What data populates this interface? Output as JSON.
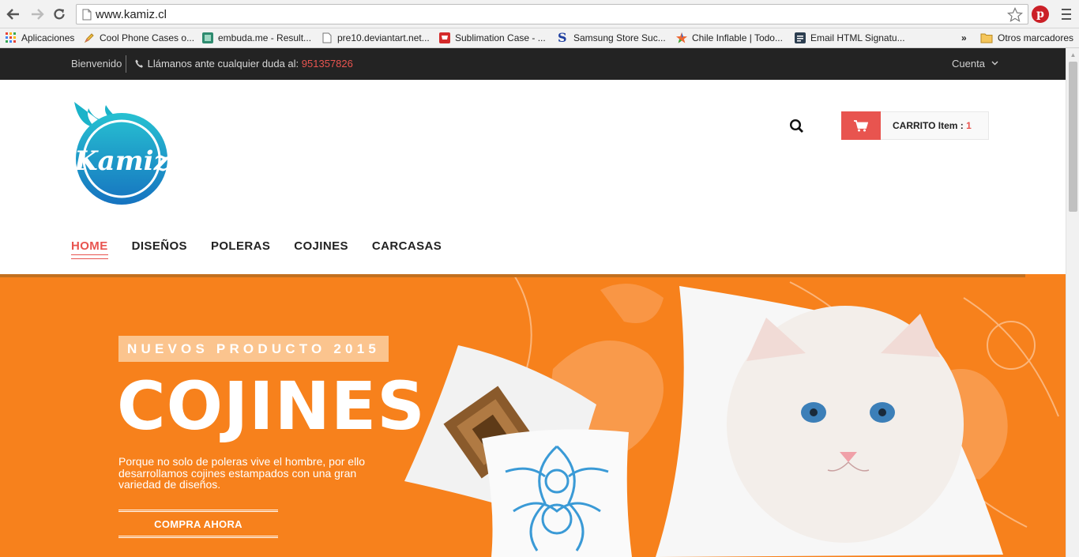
{
  "browser": {
    "url": "www.kamiz.cl",
    "bookmarks": [
      {
        "label": "Aplicaciones",
        "icon": "apps-grid-icon"
      },
      {
        "label": "Cool Phone Cases o...",
        "icon": "pencil-icon"
      },
      {
        "label": "embuda.me - Result...",
        "icon": "embuda-icon"
      },
      {
        "label": "pre10.deviantart.net...",
        "icon": "page-icon"
      },
      {
        "label": "Sublimation Case - ...",
        "icon": "cart-red-icon"
      },
      {
        "label": "Samsung Store Suc...",
        "icon": "samsung-s-icon"
      },
      {
        "label": "Chile Inflable | Todo...",
        "icon": "star-multicolor-icon"
      },
      {
        "label": "Email HTML Signatu...",
        "icon": "email-sig-icon"
      }
    ],
    "overflow_label": "»",
    "other_bookmarks": "Otros marcadores"
  },
  "topbar": {
    "welcome": "Bienvenido",
    "call_text": "Llámanos ante cualquier duda al:",
    "phone": "951357826",
    "account": "Cuenta"
  },
  "header": {
    "logo_alt": "Kamiz",
    "cart_label": "CARRITO Item :",
    "cart_count": "1"
  },
  "nav": {
    "items": [
      {
        "label": "HOME",
        "active": true
      },
      {
        "label": "DISEÑOS",
        "active": false
      },
      {
        "label": "POLERAS",
        "active": false
      },
      {
        "label": "COJINES",
        "active": false
      },
      {
        "label": "CARCASAS",
        "active": false
      }
    ]
  },
  "hero": {
    "tag": "NUEVOS PRODUCTO 2015",
    "title": "COJINES",
    "description": "Porque no solo de poleras vive el hombre, por ello desarrollamos cojines estampados con una gran variedad de diseños.",
    "cta": "COMPRA AHORA"
  },
  "colors": {
    "accent": "#e8544f",
    "hero_bg": "#f7811c",
    "topbar_bg": "#232323",
    "logo_teal": "#1bb3c9",
    "logo_blue": "#1a7fc4"
  }
}
